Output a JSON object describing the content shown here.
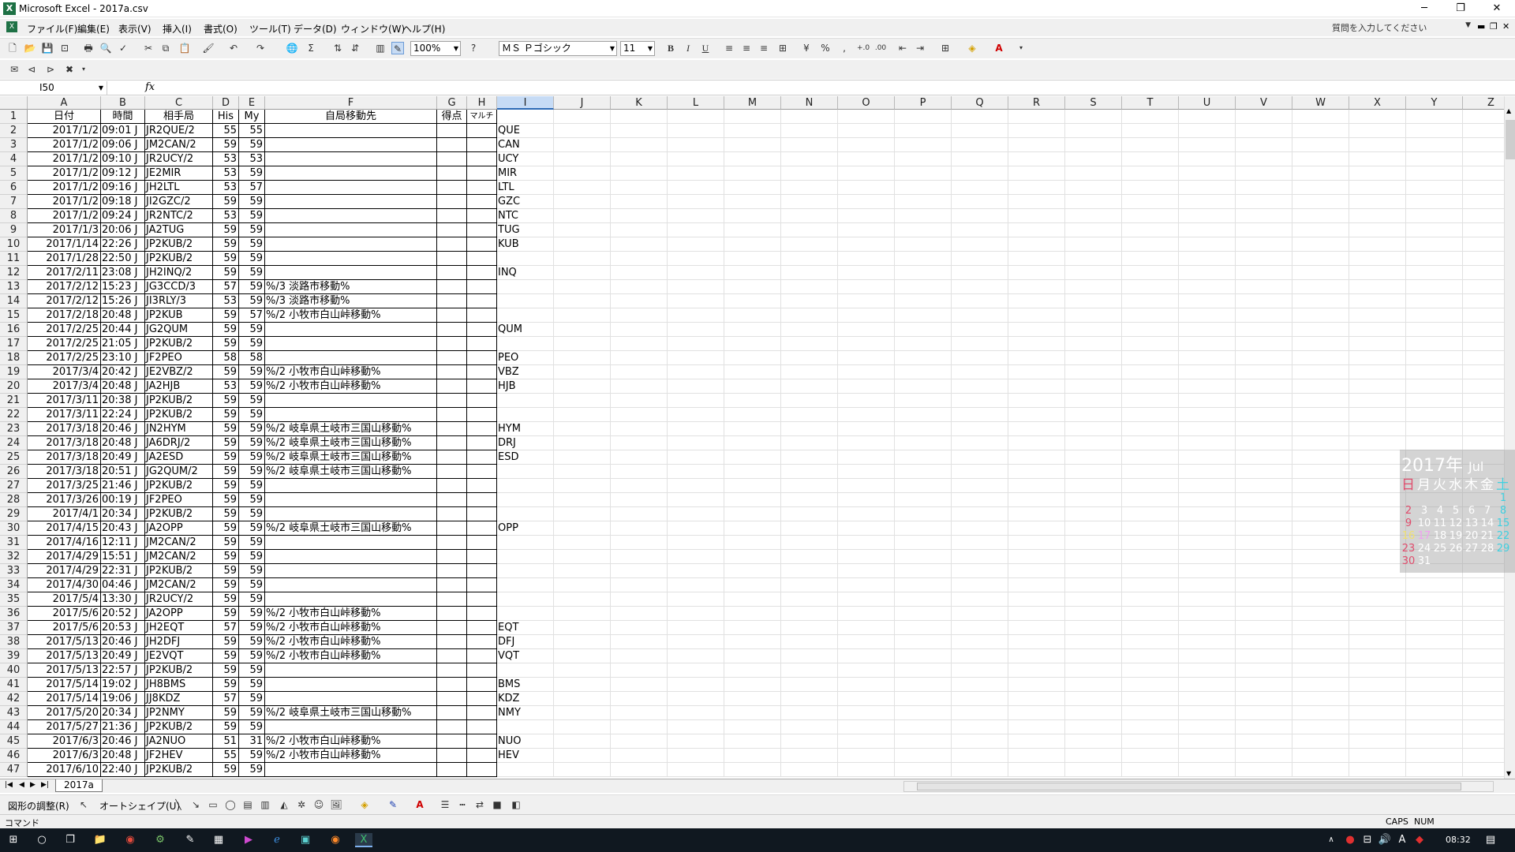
{
  "window": {
    "title": "Microsoft Excel - 2017a.csv",
    "minimize": "─",
    "restore": "❐",
    "close": "✕"
  },
  "menu": {
    "items": [
      "ファイル(F)",
      "編集(E)",
      "表示(V)",
      "挿入(I)",
      "書式(O)",
      "ツール(T)",
      "データ(D)",
      "ウィンドウ(W)",
      "ヘルプ(H)"
    ],
    "help_placeholder": "質問を入力してください"
  },
  "toolbar": {
    "zoom": "100%",
    "font_name": "ＭＳ Ｐゴシック",
    "font_size": "11",
    "bold": "B",
    "italic": "I",
    "underline": "U",
    "percent": "%",
    "comma": ","
  },
  "formula_bar": {
    "name_box": "I50",
    "fx": "fx",
    "formula": ""
  },
  "columns": [
    "A",
    "B",
    "C",
    "D",
    "E",
    "F",
    "G",
    "H",
    "I",
    "J",
    "K",
    "L",
    "M",
    "N",
    "O",
    "P",
    "Q",
    "R",
    "S",
    "T",
    "U",
    "V",
    "W",
    "X",
    "Y",
    "Z"
  ],
  "selected_column": "I",
  "headers": [
    "日付",
    "時間",
    "相手局",
    "His",
    "My",
    "自局移動先",
    "得点",
    "マルチ",
    ""
  ],
  "rows": [
    [
      "2017/1/2",
      "09:01 J",
      "JR2QUE/2",
      "55",
      "55",
      "",
      "",
      "",
      "QUE"
    ],
    [
      "2017/1/2",
      "09:06 J",
      "JM2CAN/2",
      "59",
      "59",
      "",
      "",
      "",
      "CAN"
    ],
    [
      "2017/1/2",
      "09:10 J",
      "JR2UCY/2",
      "53",
      "53",
      "",
      "",
      "",
      "UCY"
    ],
    [
      "2017/1/2",
      "09:12 J",
      "JE2MIR",
      "53",
      "59",
      "",
      "",
      "",
      "MIR"
    ],
    [
      "2017/1/2",
      "09:16 J",
      "JH2LTL",
      "53",
      "57",
      "",
      "",
      "",
      "LTL"
    ],
    [
      "2017/1/2",
      "09:18 J",
      "JI2GZC/2",
      "59",
      "59",
      "",
      "",
      "",
      "GZC"
    ],
    [
      "2017/1/2",
      "09:24 J",
      "JR2NTC/2",
      "53",
      "59",
      "",
      "",
      "",
      "NTC"
    ],
    [
      "2017/1/3",
      "20:06 J",
      "JA2TUG",
      "59",
      "59",
      "",
      "",
      "",
      "TUG"
    ],
    [
      "2017/1/14",
      "22:26 J",
      "JP2KUB/2",
      "59",
      "59",
      "",
      "",
      "",
      "KUB"
    ],
    [
      "2017/1/28",
      "22:50 J",
      "JP2KUB/2",
      "59",
      "59",
      "",
      "",
      "",
      ""
    ],
    [
      "2017/2/11",
      "23:08 J",
      "JH2INQ/2",
      "59",
      "59",
      "",
      "",
      "",
      "INQ"
    ],
    [
      "2017/2/12",
      "15:23 J",
      "JG3CCD/3",
      "57",
      "59",
      "%/3 淡路市移動%",
      "",
      "",
      ""
    ],
    [
      "2017/2/12",
      "15:26 J",
      "JI3RLY/3",
      "53",
      "59",
      "%/3 淡路市移動%",
      "",
      "",
      ""
    ],
    [
      "2017/2/18",
      "20:48 J",
      "JP2KUB",
      "59",
      "57",
      "%/2 小牧市白山峠移動%",
      "",
      "",
      ""
    ],
    [
      "2017/2/25",
      "20:44 J",
      "JG2QUM",
      "59",
      "59",
      "",
      "",
      "",
      "QUM"
    ],
    [
      "2017/2/25",
      "21:05 J",
      "JP2KUB/2",
      "59",
      "59",
      "",
      "",
      "",
      ""
    ],
    [
      "2017/2/25",
      "23:10 J",
      "JF2PEO",
      "58",
      "58",
      "",
      "",
      "",
      "PEO"
    ],
    [
      "2017/3/4",
      "20:42 J",
      "JE2VBZ/2",
      "59",
      "59",
      "%/2 小牧市白山峠移動%",
      "",
      "",
      "VBZ"
    ],
    [
      "2017/3/4",
      "20:48 J",
      "JA2HJB",
      "53",
      "59",
      "%/2 小牧市白山峠移動%",
      "",
      "",
      "HJB"
    ],
    [
      "2017/3/11",
      "20:38 J",
      "JP2KUB/2",
      "59",
      "59",
      "",
      "",
      "",
      ""
    ],
    [
      "2017/3/11",
      "22:24 J",
      "JP2KUB/2",
      "59",
      "59",
      "",
      "",
      "",
      ""
    ],
    [
      "2017/3/18",
      "20:46 J",
      "JN2HYM",
      "59",
      "59",
      "%/2 岐阜県土岐市三国山移動%",
      "",
      "",
      "HYM"
    ],
    [
      "2017/3/18",
      "20:48 J",
      "JA6DRJ/2",
      "59",
      "59",
      "%/2 岐阜県土岐市三国山移動%",
      "",
      "",
      "DRJ"
    ],
    [
      "2017/3/18",
      "20:49 J",
      "JA2ESD",
      "59",
      "59",
      "%/2 岐阜県土岐市三国山移動%",
      "",
      "",
      "ESD"
    ],
    [
      "2017/3/18",
      "20:51 J",
      "JG2QUM/2",
      "59",
      "59",
      "%/2 岐阜県土岐市三国山移動%",
      "",
      "",
      ""
    ],
    [
      "2017/3/25",
      "21:46 J",
      "JP2KUB/2",
      "59",
      "59",
      "",
      "",
      "",
      ""
    ],
    [
      "2017/3/26",
      "00:19 J",
      "JF2PEO",
      "59",
      "59",
      "",
      "",
      "",
      ""
    ],
    [
      "2017/4/1",
      "20:34 J",
      "JP2KUB/2",
      "59",
      "59",
      "",
      "",
      "",
      ""
    ],
    [
      "2017/4/15",
      "20:43 J",
      "JA2OPP",
      "59",
      "59",
      "%/2 岐阜県土岐市三国山移動%",
      "",
      "",
      "OPP"
    ],
    [
      "2017/4/16",
      "12:11 J",
      "JM2CAN/2",
      "59",
      "59",
      "",
      "",
      "",
      ""
    ],
    [
      "2017/4/29",
      "15:51 J",
      "JM2CAN/2",
      "59",
      "59",
      "",
      "",
      "",
      ""
    ],
    [
      "2017/4/29",
      "22:31 J",
      "JP2KUB/2",
      "59",
      "59",
      "",
      "",
      "",
      ""
    ],
    [
      "2017/4/30",
      "04:46 J",
      "JM2CAN/2",
      "59",
      "59",
      "",
      "",
      "",
      ""
    ],
    [
      "2017/5/4",
      "13:30 J",
      "JR2UCY/2",
      "59",
      "59",
      "",
      "",
      "",
      ""
    ],
    [
      "2017/5/6",
      "20:52 J",
      "JA2OPP",
      "59",
      "59",
      "%/2 小牧市白山峠移動%",
      "",
      "",
      ""
    ],
    [
      "2017/5/6",
      "20:53 J",
      "JH2EQT",
      "57",
      "59",
      "%/2 小牧市白山峠移動%",
      "",
      "",
      "EQT"
    ],
    [
      "2017/5/13",
      "20:46 J",
      "JH2DFJ",
      "59",
      "59",
      "%/2 小牧市白山峠移動%",
      "",
      "",
      "DFJ"
    ],
    [
      "2017/5/13",
      "20:49 J",
      "JE2VQT",
      "59",
      "59",
      "%/2 小牧市白山峠移動%",
      "",
      "",
      "VQT"
    ],
    [
      "2017/5/13",
      "22:57 J",
      "JP2KUB/2",
      "59",
      "59",
      "",
      "",
      "",
      ""
    ],
    [
      "2017/5/14",
      "19:02 J",
      "JH8BMS",
      "59",
      "59",
      "",
      "",
      "",
      "BMS"
    ],
    [
      "2017/5/14",
      "19:06 J",
      "JJ8KDZ",
      "57",
      "59",
      "",
      "",
      "",
      "KDZ"
    ],
    [
      "2017/5/20",
      "20:34 J",
      "JP2NMY",
      "59",
      "59",
      "%/2 岐阜県土岐市三国山移動%",
      "",
      "",
      "NMY"
    ],
    [
      "2017/5/27",
      "21:36 J",
      "JP2KUB/2",
      "59",
      "59",
      "",
      "",
      "",
      ""
    ],
    [
      "2017/6/3",
      "20:46 J",
      "JA2NUO",
      "51",
      "31",
      "%/2 小牧市白山峠移動%",
      "",
      "",
      "NUO"
    ],
    [
      "2017/6/3",
      "20:48 J",
      "JF2HEV",
      "55",
      "59",
      "%/2 小牧市白山峠移動%",
      "",
      "",
      "HEV"
    ],
    [
      "2017/6/10",
      "22:40 J",
      "JP2KUB/2",
      "59",
      "59",
      "",
      "",
      "",
      ""
    ]
  ],
  "sheet": {
    "tab_name": "2017a"
  },
  "drawing_toolbar": {
    "draw_label": "図形の調整(R)",
    "autoshape_label": "オートシェイプ(U)"
  },
  "status": {
    "left": "コマンド",
    "caps": "CAPS",
    "num": "NUM"
  },
  "taskbar": {
    "time": "08:32"
  },
  "calendar_widget": {
    "year": "2017年",
    "month": "Jul",
    "weekdays": [
      "日",
      "月",
      "火",
      "水",
      "木",
      "金",
      "土"
    ],
    "weeks": [
      [
        "",
        "",
        "",
        "",
        "",
        "",
        "1"
      ],
      [
        "2",
        "3",
        "4",
        "5",
        "6",
        "7",
        "8"
      ],
      [
        "9",
        "10",
        "11",
        "12",
        "13",
        "14",
        "15"
      ],
      [
        "16",
        "17",
        "18",
        "19",
        "20",
        "21",
        "22"
      ],
      [
        "23",
        "24",
        "25",
        "26",
        "27",
        "28",
        "29"
      ],
      [
        "30",
        "31",
        "",
        "",
        "",
        "",
        ""
      ]
    ]
  }
}
